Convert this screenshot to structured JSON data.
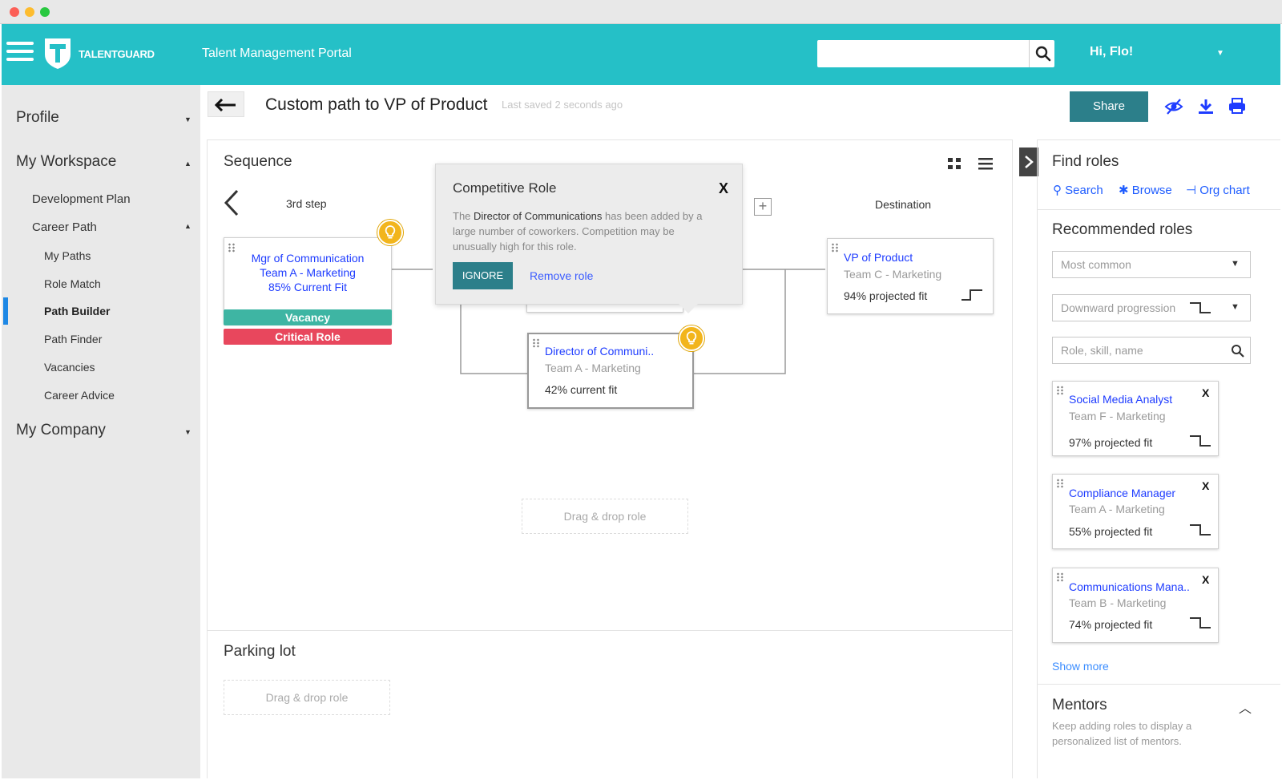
{
  "window": {
    "colors": {
      "close": "#fc5f57",
      "minimize": "#fdbc2e",
      "maximize": "#29c840",
      "accent": "#25c0c7",
      "brand_dark": "#2c7f8a",
      "critical": "#e8475d",
      "vacancy": "#3eb5a3",
      "link": "#1e3cff",
      "bulb": "#f2b51c"
    }
  },
  "header": {
    "logo_text": "TALENTGUARD",
    "portal_title": "Talent Management Portal",
    "search_value": "",
    "greeting": "Hi, Flo!"
  },
  "sidebar": {
    "profile": "Profile",
    "my_workspace": "My Workspace",
    "development_plan": "Development Plan",
    "career_path": "Career Path",
    "items": [
      "My Paths",
      "Role Match",
      "Path Builder",
      "Path Finder",
      "Vacancies",
      "Career Advice"
    ],
    "active_item": "Path Builder",
    "my_company": "My Company"
  },
  "page": {
    "title": "Custom path to VP of Product",
    "saved": "Last saved 2 seconds ago",
    "share": "Share"
  },
  "sequence": {
    "title": "Sequence",
    "step_label": "3rd step",
    "destination_label": "Destination",
    "card1": {
      "title": "Mgr of Communication",
      "team": "Team A - Marketing",
      "fit": "85% Current Fit",
      "badge1": "Vacancy",
      "badge2": "Critical Role"
    },
    "card2": {
      "title": "Director of Communi..",
      "team": "Team A - Marketing",
      "fit": "42% current fit"
    },
    "card3": {
      "title": "VP of Product",
      "team": "Team C - Marketing",
      "fit": "94% projected fit"
    },
    "drop": "Drag & drop role"
  },
  "popup": {
    "title": "Competitive Role",
    "close": "X",
    "text_pre": "The ",
    "text_bold": "Director of Communications",
    "text_post": " has been added by a large number of coworkers. Competition may be unusually high for this role.",
    "ignore": "IGNORE",
    "remove": "Remove role"
  },
  "parking": {
    "title": "Parking lot",
    "drop": "Drag & drop role"
  },
  "find_roles": {
    "title": "Find roles",
    "search": "Search",
    "browse": "Browse",
    "org_chart": "Org chart",
    "recommended": "Recommended roles",
    "filter1": "Most common",
    "filter2": "Downward progression",
    "search_placeholder": "Role, skill, name",
    "roles": [
      {
        "title": "Social Media Analyst",
        "team": "Team F - Marketing",
        "fit": "97% projected fit"
      },
      {
        "title": "Compliance Manager",
        "team": "Team A - Marketing",
        "fit": "55% projected fit"
      },
      {
        "title": "Communications Mana..",
        "team": "Team B - Marketing",
        "fit": "74% projected fit"
      }
    ],
    "remove": "X",
    "show_more": "Show more",
    "mentors": "Mentors",
    "mentors_text": "Keep adding roles to display a personalized list of mentors."
  }
}
